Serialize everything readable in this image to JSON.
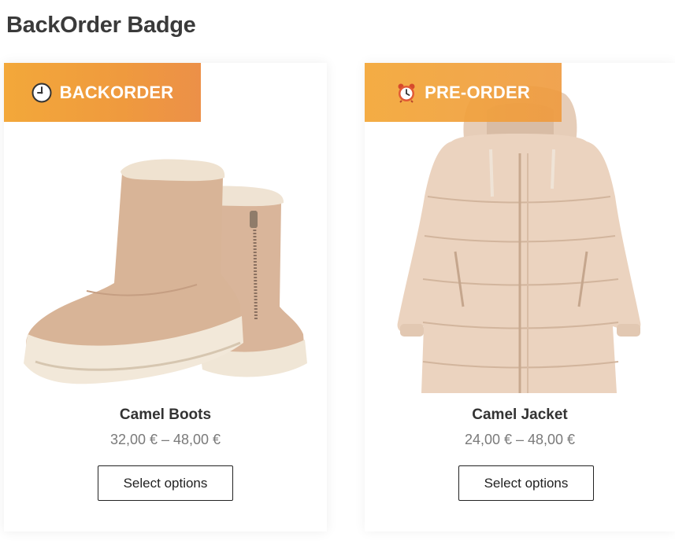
{
  "page": {
    "title": "BackOrder Badge"
  },
  "colors": {
    "badge": "#f0a040",
    "badge_text": "#ffffff",
    "button_border": "#222222",
    "price": "#7a7a7a"
  },
  "products": [
    {
      "name": "Camel Boots",
      "price": "32,00 € – 48,00 €",
      "button_label": "Select options",
      "badge": {
        "label": "BACKORDER",
        "icon": "clock-icon"
      },
      "image": "camel-boots-image"
    },
    {
      "name": "Camel Jacket",
      "price": "24,00 € – 48,00 €",
      "button_label": "Select options",
      "badge": {
        "label": "PRE-ORDER",
        "icon": "alarm-clock-icon"
      },
      "image": "camel-jacket-image"
    }
  ]
}
